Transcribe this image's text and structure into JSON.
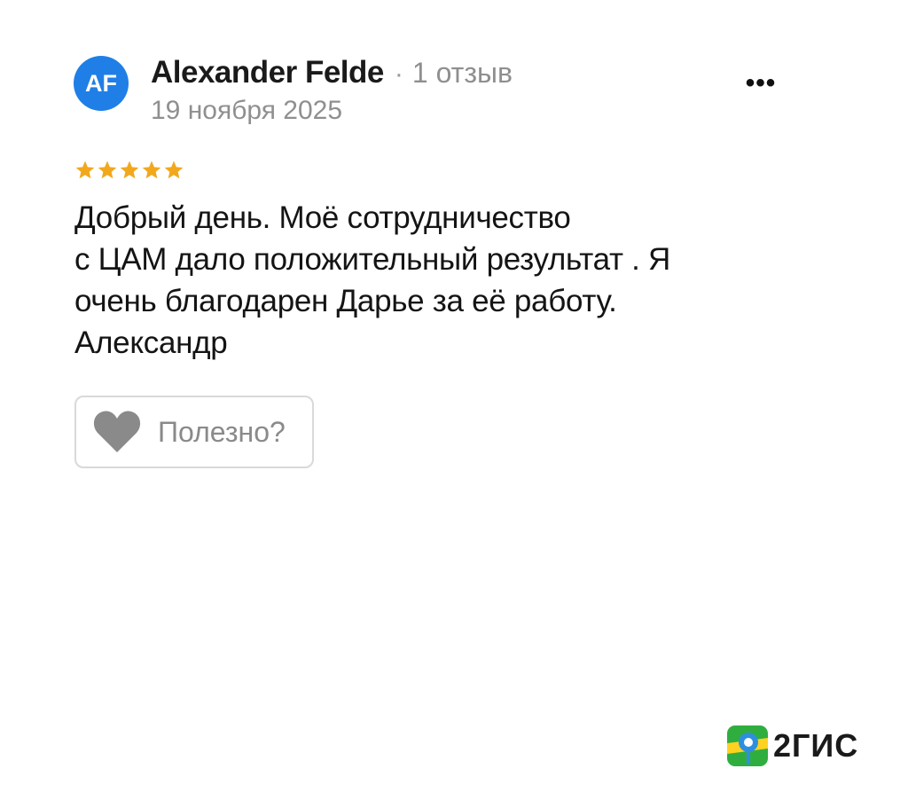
{
  "review": {
    "avatar_initials": "AF",
    "author_name": "Alexander Felde",
    "separator": "·",
    "review_count": "1 отзыв",
    "date": "19 ноября 2025",
    "more_label": "•••",
    "rating": 5,
    "rating_max": 5,
    "text": "Добрый день. Моё сотрудничество\nс ЦАМ дало положительный результат . Я\nочень благодарен  Дарье за её работу.\nАлександр",
    "helpful_label": "Полезно?"
  },
  "brand": {
    "name": "2ГИС",
    "icon": "2gis-logo-icon"
  },
  "colors": {
    "avatar_bg": "#1f7fe6",
    "star": "#f2a81d",
    "heart": "#8a8a8a",
    "muted_text": "#8f8f8f",
    "brand_green": "#2fae3f",
    "brand_blue": "#2e8fe0",
    "brand_yellow": "#ffd21f"
  }
}
